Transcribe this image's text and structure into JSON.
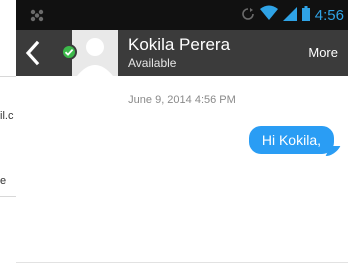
{
  "background_fragments": [
    "il.c",
    "e"
  ],
  "status_bar": {
    "time": "4:56",
    "icons": [
      "notification-icon",
      "rotate-icon",
      "wifi-icon",
      "signal-icon",
      "battery-icon"
    ]
  },
  "toolbar": {
    "back_icon": "chevron-left-icon",
    "contact_name": "Kokila Perera",
    "contact_status": "Available",
    "more_label": "More"
  },
  "conversation": {
    "date_header": "June 9, 2014 4:56 PM",
    "messages": [
      {
        "direction": "outgoing",
        "text": "Hi Kokila,"
      }
    ]
  },
  "colors": {
    "status_time": "#2fa3e6",
    "toolbar_bg": "#3b3b3b",
    "bubble_bg": "#2a9df4",
    "presence_available": "#3cb94a"
  }
}
